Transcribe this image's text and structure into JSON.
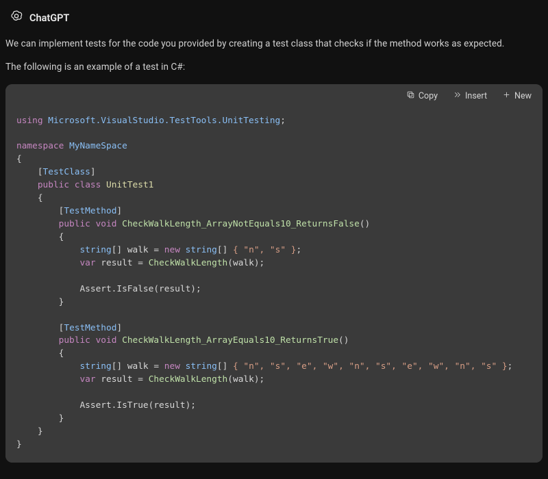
{
  "header": {
    "title": "ChatGPT"
  },
  "message": {
    "p1": "We can implement tests for the code you provided by creating a test class that checks if the method works as expected.",
    "p2": "The following is an example of a test in C#:"
  },
  "toolbar": {
    "copy": "Copy",
    "insert": "Insert",
    "new": "New"
  },
  "code": {
    "kw_using": "using",
    "using_ns": "Microsoft.VisualStudio.TestTools.UnitTesting",
    "kw_namespace": "namespace",
    "namespace_name": "MyNameSpace",
    "attr_testclass": "TestClass",
    "kw_public": "public",
    "kw_class": "class",
    "class_name": "UnitTest1",
    "attr_testmethod": "TestMethod",
    "kw_void": "void",
    "method1": "CheckWalkLength_ArrayNotEquals10_ReturnsFalse",
    "type_string": "string",
    "var_walk": "walk",
    "kw_new": "new",
    "arr1": "{ \"n\", \"s\" }",
    "kw_var": "var",
    "var_result": "result",
    "call_cwl": "CheckWalkLength",
    "assert_isfalse": "Assert.IsFalse",
    "method2": "CheckWalkLength_ArrayEquals10_ReturnsTrue",
    "arr2": "{ \"n\", \"s\", \"e\", \"w\", \"n\", \"s\", \"e\", \"w\", \"n\", \"s\" }",
    "assert_istrue": "Assert.IsTrue"
  }
}
